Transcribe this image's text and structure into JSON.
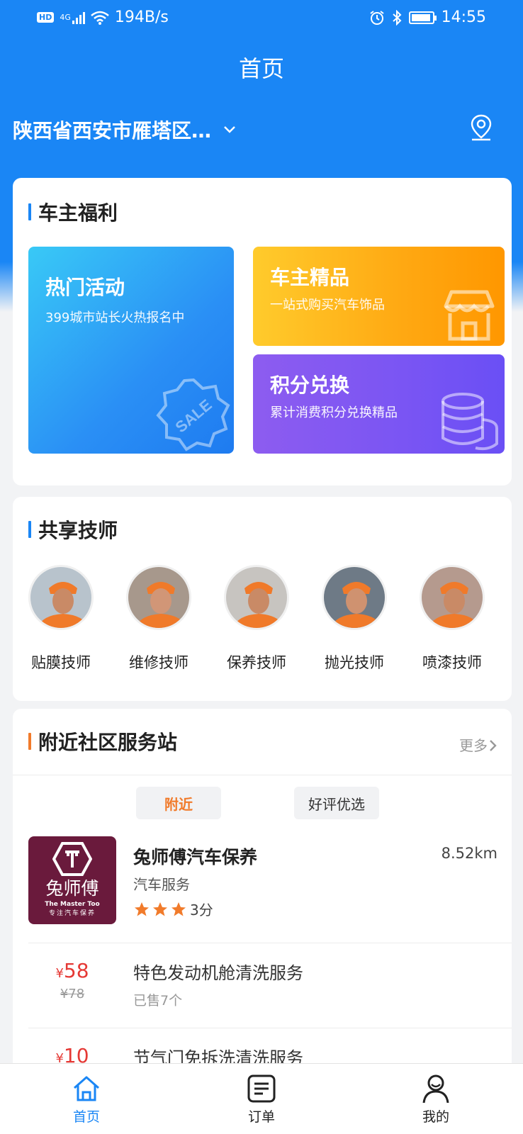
{
  "status_bar": {
    "network": "HD",
    "signal": "4G",
    "speed": "194B/s",
    "time": "14:55"
  },
  "header": {
    "title": "首页"
  },
  "location": {
    "text": "陕西省西安市雁塔区…"
  },
  "welfare": {
    "title": "车主福利",
    "hot": {
      "title": "热门活动",
      "subtitle": "399城市站长火热报名中",
      "badge": "SALE"
    },
    "premium": {
      "title": "车主精品",
      "subtitle": "一站式购买汽车饰品"
    },
    "points": {
      "title": "积分兑换",
      "subtitle": "累计消费积分兑换精品"
    }
  },
  "technicians": {
    "title": "共享技师",
    "items": [
      {
        "label": "贴膜技师"
      },
      {
        "label": "维修技师"
      },
      {
        "label": "保养技师"
      },
      {
        "label": "抛光技师"
      },
      {
        "label": "喷漆技师"
      }
    ]
  },
  "nearby": {
    "title": "附近社区服务站",
    "more": "更多",
    "tabs": [
      {
        "label": "附近",
        "active": true
      },
      {
        "label": "好评优选",
        "active": false
      }
    ],
    "store": {
      "name": "兔师傅汽车保养",
      "category": "汽车服务",
      "distance": "8.52km",
      "rating_text": "3分",
      "stars": 3,
      "logo_cn": "兔师傅",
      "logo_en": "The Master Too",
      "logo_tag": "专注汽车保养"
    },
    "services": [
      {
        "currency": "¥",
        "price": "58",
        "old_price": "¥78",
        "name": "特色发动机舱清洗服务",
        "sold": "已售7个"
      },
      {
        "currency": "¥",
        "price": "10",
        "old_price": "",
        "name": "节气门免拆洗清洗服务",
        "sold": ""
      }
    ]
  },
  "tabbar": {
    "items": [
      {
        "label": "首页",
        "icon": "home-icon",
        "active": true
      },
      {
        "label": "订单",
        "icon": "order-icon",
        "active": false
      },
      {
        "label": "我的",
        "icon": "user-icon",
        "active": false
      }
    ]
  },
  "colors": {
    "primary": "#1a86f5",
    "accent": "#f17b2b",
    "price": "#e53935"
  }
}
